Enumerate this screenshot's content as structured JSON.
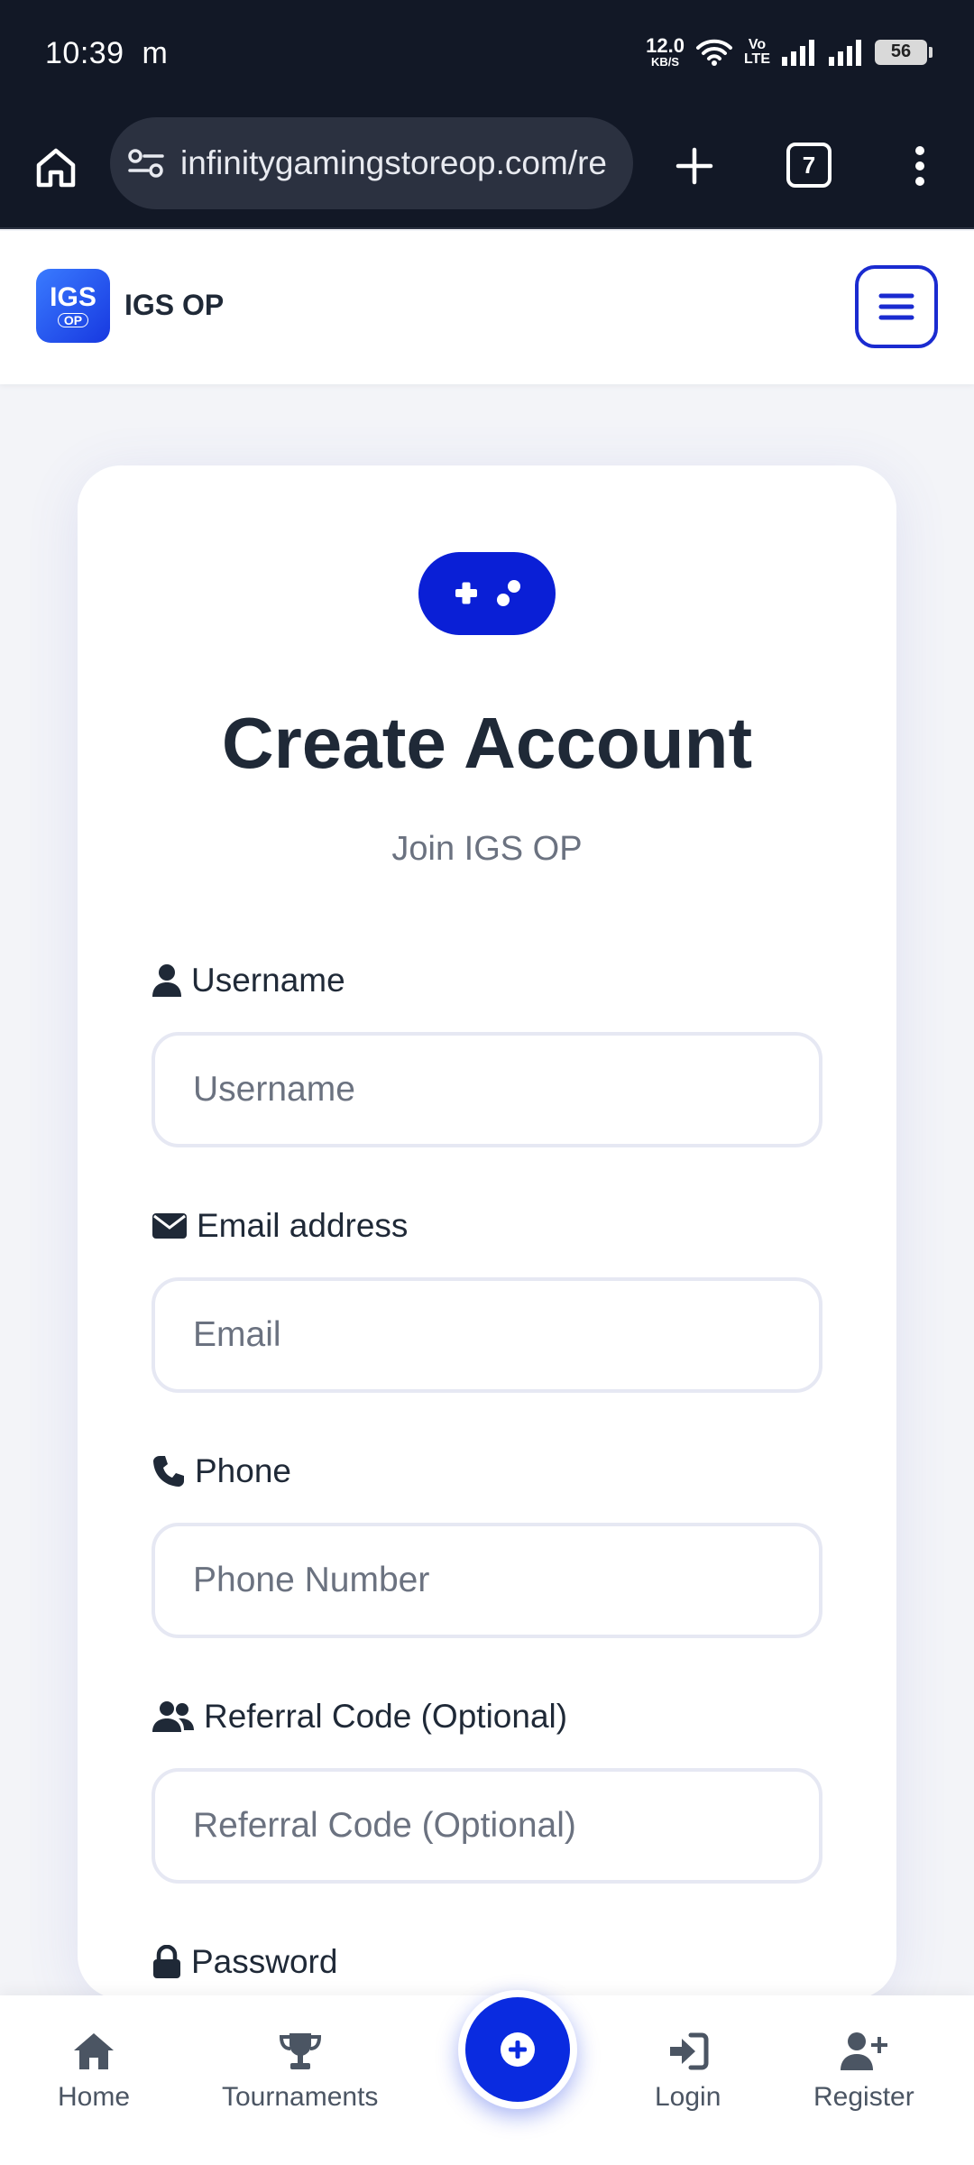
{
  "status_bar": {
    "time": "10:39",
    "carrier_icon": "m",
    "speed_value": "12.0",
    "speed_unit": "KB/S",
    "volte_top": "Vo",
    "volte_bottom": "LTE",
    "battery": "56"
  },
  "browser": {
    "url": "infinitygamingstoreop.com/re",
    "tab_count": "7"
  },
  "header": {
    "logo_top": "IGS",
    "logo_bottom": "OP",
    "brand": "IGS OP"
  },
  "form": {
    "title": "Create Account",
    "subtitle": "Join IGS OP",
    "fields": [
      {
        "label": "Username",
        "placeholder": "Username",
        "icon": "user-icon"
      },
      {
        "label": "Email address",
        "placeholder": "Email",
        "icon": "envelope-icon"
      },
      {
        "label": "Phone",
        "placeholder": "Phone Number",
        "icon": "phone-icon"
      },
      {
        "label": "Referral Code (Optional)",
        "placeholder": "Referral Code (Optional)",
        "icon": "users-icon"
      },
      {
        "label": "Password",
        "icon": "lock-icon"
      }
    ]
  },
  "bottom_nav": {
    "home": "Home",
    "tournaments": "Tournaments",
    "login": "Login",
    "register": "Register"
  },
  "colors": {
    "accent": "#0a2be0",
    "browser_bg": "#121826",
    "page_bg": "#f3f4f8",
    "text_dark": "#1f2937",
    "text_muted": "#6b7280"
  }
}
